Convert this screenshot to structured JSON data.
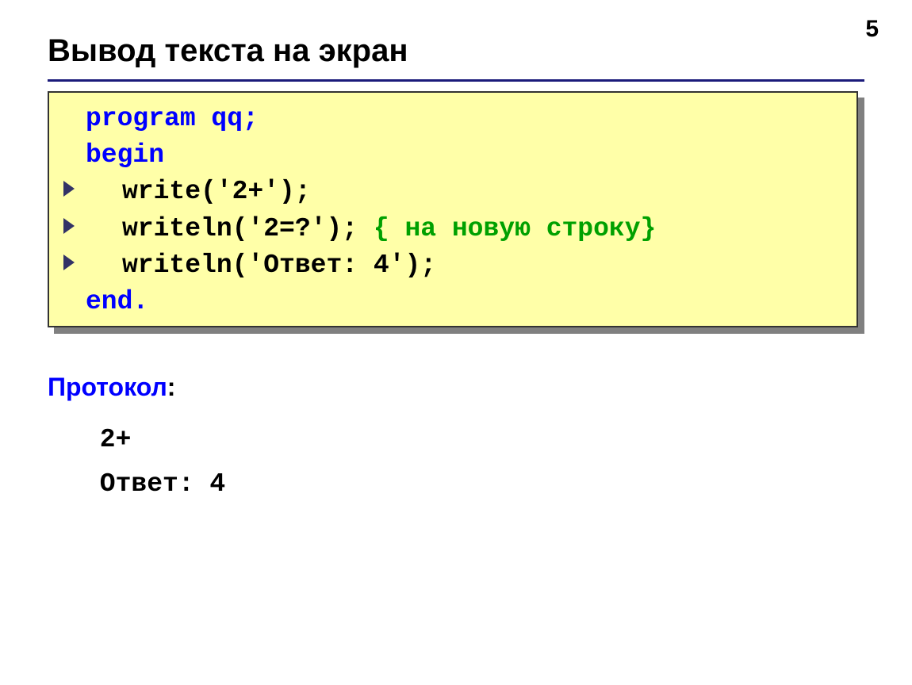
{
  "page_number": "5",
  "title": "Вывод текста на экран",
  "code": {
    "line1_main": "program qq;",
    "line2_main": "begin",
    "line3_main": "write('2+');",
    "line4_main": "writeln('2=?'); ",
    "line4_comment": "{ на новую строку}",
    "line5_main": "writeln('Ответ: 4');",
    "line6_main": "end."
  },
  "protocol": {
    "label": "Протокол",
    "colon": ":",
    "output_line1": " 2+",
    "output_line2": " Ответ: 4"
  }
}
